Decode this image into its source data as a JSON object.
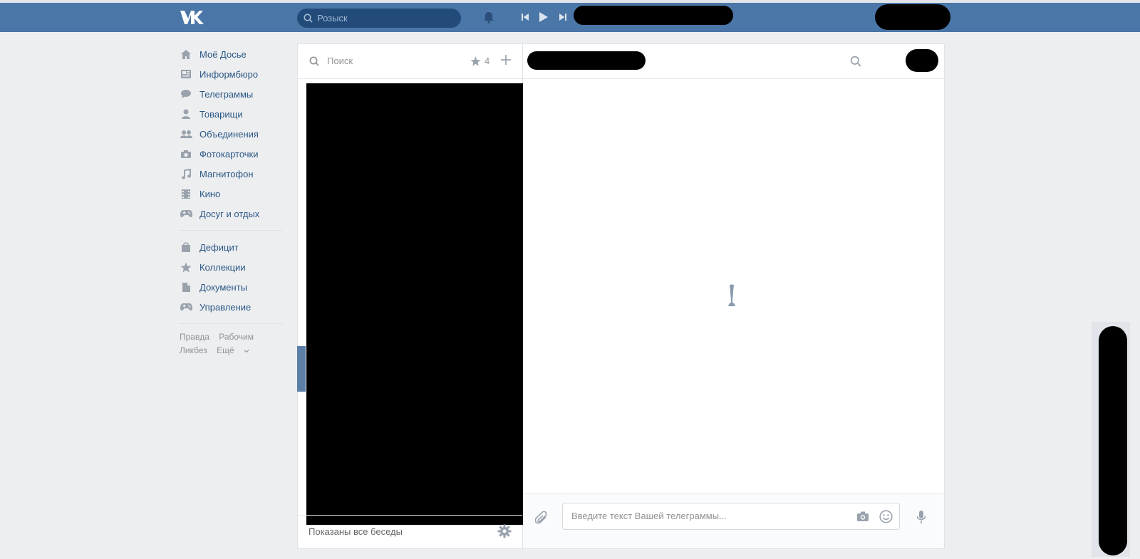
{
  "header": {
    "logo": "VK",
    "search_placeholder": "Розыск"
  },
  "sidebar": {
    "items": [
      {
        "label": "Моё Досье",
        "icon": "home-icon"
      },
      {
        "label": "Информбюро",
        "icon": "news-icon"
      },
      {
        "label": "Телеграммы",
        "icon": "messages-icon"
      },
      {
        "label": "Товарищи",
        "icon": "friends-icon"
      },
      {
        "label": "Объединения",
        "icon": "groups-icon"
      },
      {
        "label": "Фотокарточки",
        "icon": "camera-icon"
      },
      {
        "label": "Магнитофон",
        "icon": "music-icon"
      },
      {
        "label": "Кино",
        "icon": "video-icon"
      },
      {
        "label": "Досуг и отдых",
        "icon": "gamepad-icon"
      }
    ],
    "items2": [
      {
        "label": "Дефицит",
        "icon": "bag-icon"
      },
      {
        "label": "Коллекции",
        "icon": "star-icon"
      },
      {
        "label": "Документы",
        "icon": "document-icon"
      },
      {
        "label": "Управление",
        "icon": "gamepad-icon"
      }
    ],
    "footer": [
      "Правда",
      "Рабочим",
      "Ликбез",
      "Ещё"
    ]
  },
  "dialogs": {
    "search_placeholder": "Поиск",
    "star_count": "4",
    "footer_text": "Показаны все беседы"
  },
  "chat": {
    "input_placeholder": "Введите текст Вашей телеграммы..."
  },
  "colors": {
    "header_bg": "#4a76a8",
    "page_bg": "#edeef0",
    "link": "#2a5885",
    "icon": "#99a2ad"
  }
}
